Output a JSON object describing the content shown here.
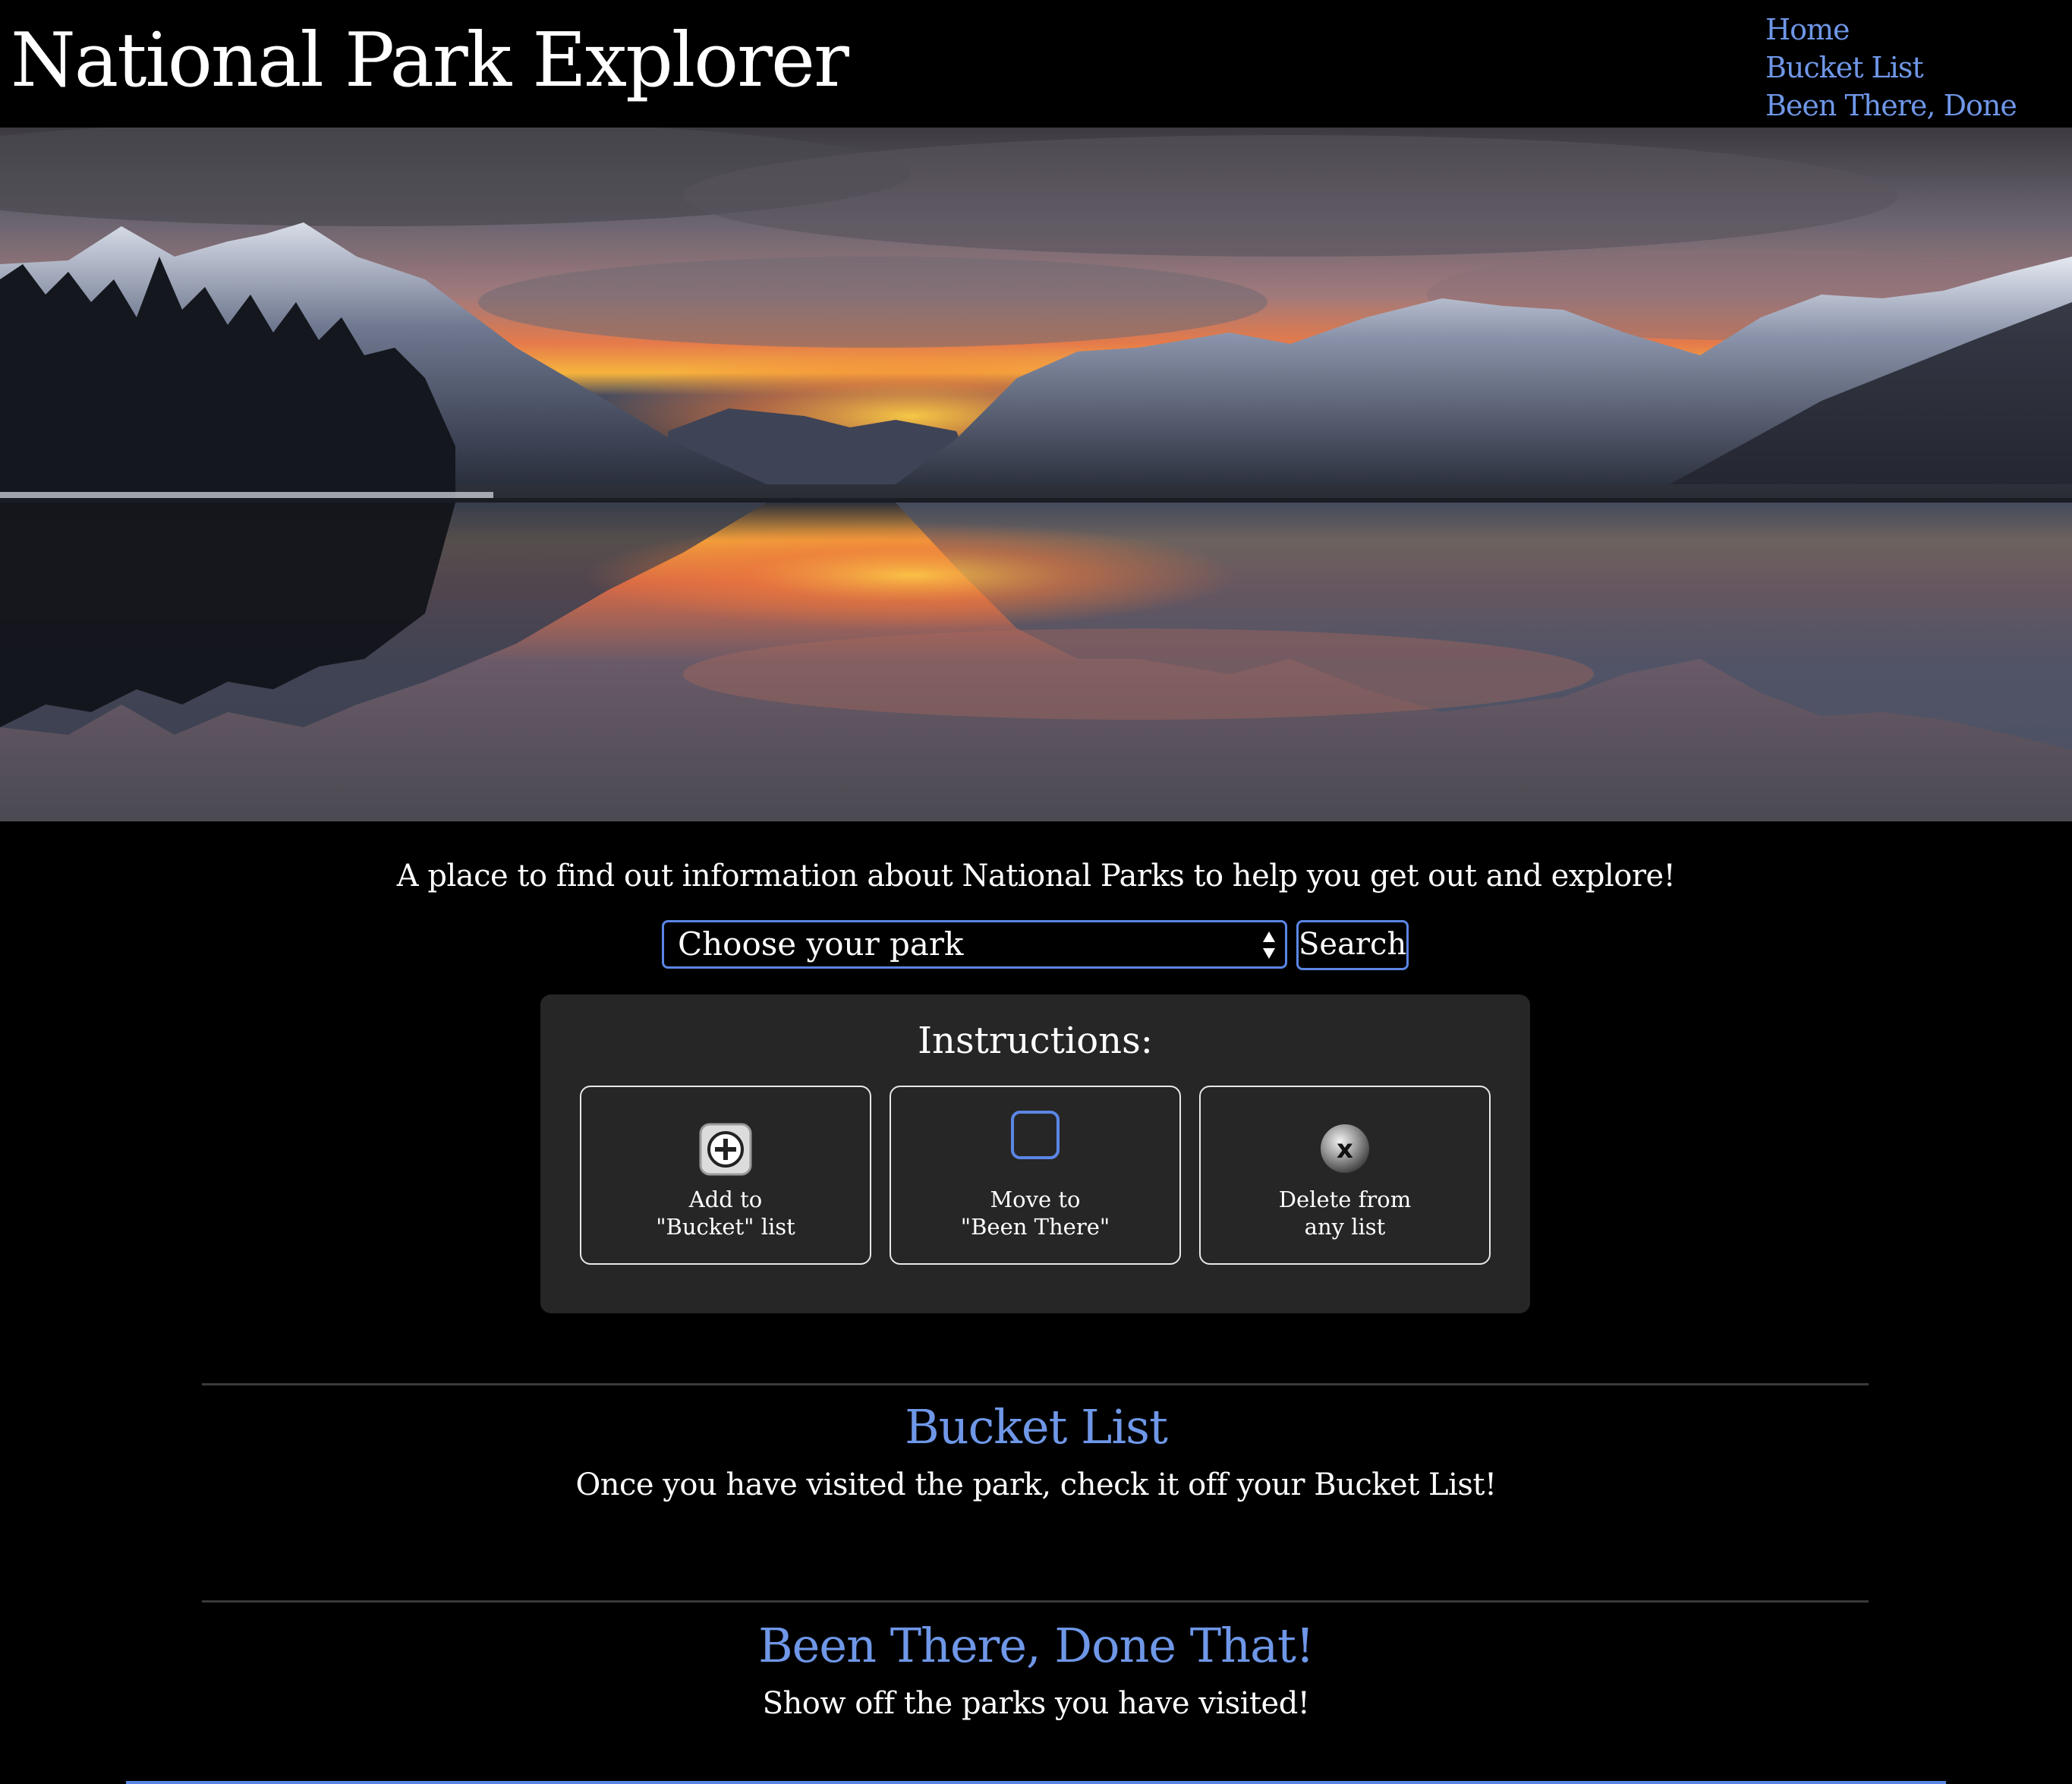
{
  "header": {
    "title": "National Park Explorer",
    "nav": [
      {
        "label": "Home"
      },
      {
        "label": "Bucket List"
      },
      {
        "label": "Been There, Done That!"
      }
    ]
  },
  "intro": {
    "tagline": "A place to find out information about National Parks to help you get out and explore!"
  },
  "search": {
    "select_value": "Choose your park",
    "button_label": "Search"
  },
  "instructions": {
    "title": "Instructions:",
    "cards": [
      {
        "icon": "add-icon",
        "line1": "Add to",
        "line2": "\"Bucket\" list"
      },
      {
        "icon": "checkbox-icon",
        "line1": "Move to",
        "line2": "\"Been There\""
      },
      {
        "icon": "delete-icon",
        "line1": "Delete from",
        "line2": "any list"
      }
    ]
  },
  "bucket_list": {
    "title": "Bucket List",
    "subtitle": "Once you have visited the park, check it off your Bucket List!"
  },
  "been_there": {
    "title": "Been There, Done That!",
    "subtitle": "Show off the parks you have visited!"
  },
  "colors": {
    "accent": "#6f97e8",
    "border": "#5b86e5",
    "panel": "#262626",
    "background": "#000000"
  }
}
